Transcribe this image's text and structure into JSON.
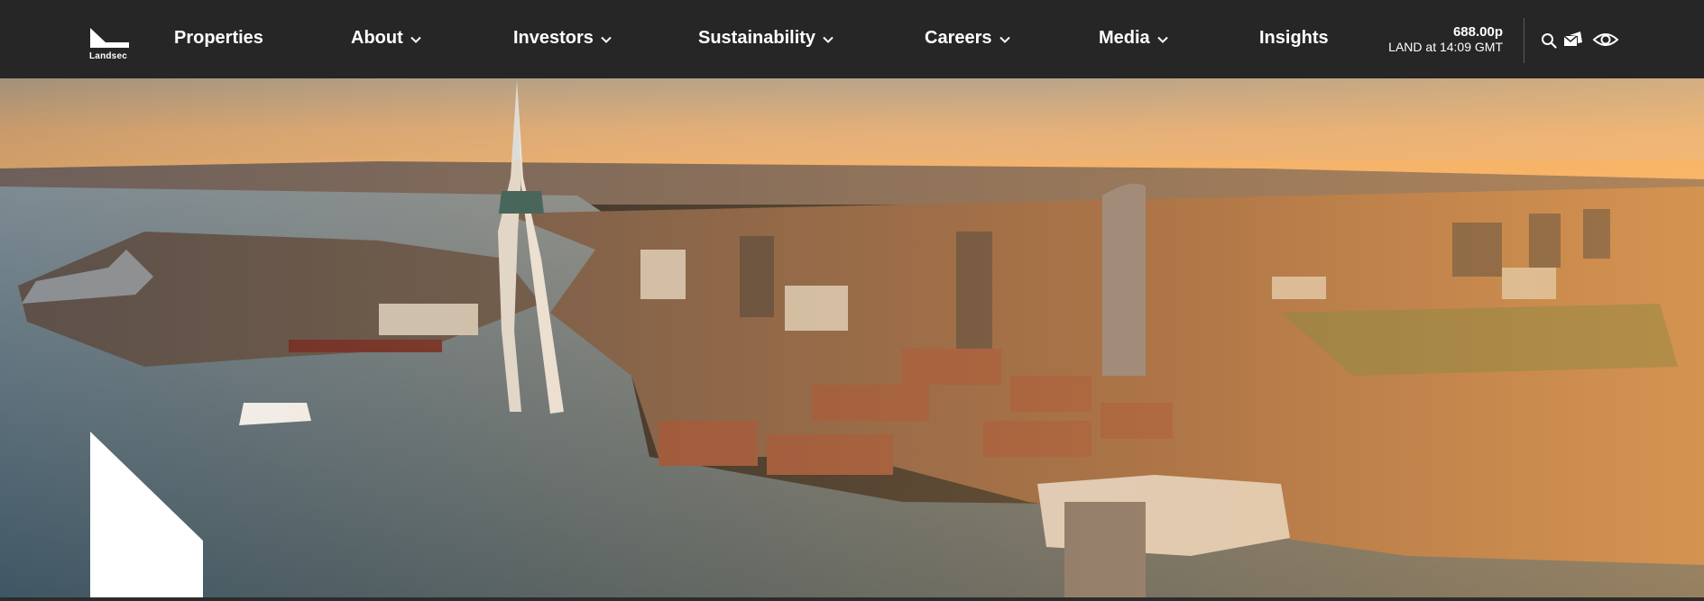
{
  "brand": {
    "name": "Landsec"
  },
  "nav": {
    "items": [
      {
        "label": "Properties",
        "has_dropdown": false
      },
      {
        "label": "About",
        "has_dropdown": true
      },
      {
        "label": "Investors",
        "has_dropdown": true
      },
      {
        "label": "Sustainability",
        "has_dropdown": true
      },
      {
        "label": "Careers",
        "has_dropdown": true
      },
      {
        "label": "Media",
        "has_dropdown": true
      },
      {
        "label": "Insights",
        "has_dropdown": false
      }
    ]
  },
  "share_price": {
    "price": "688.00p",
    "ticker_time": "LAND at 14:09 GMT"
  },
  "toolbar_icons": [
    "search-icon",
    "mail-icon",
    "eye-icon"
  ],
  "colors": {
    "nav_background": "#262626",
    "text": "#ffffff",
    "sky_top": "#a79a86",
    "sky_bottom": "#f7b66a"
  }
}
